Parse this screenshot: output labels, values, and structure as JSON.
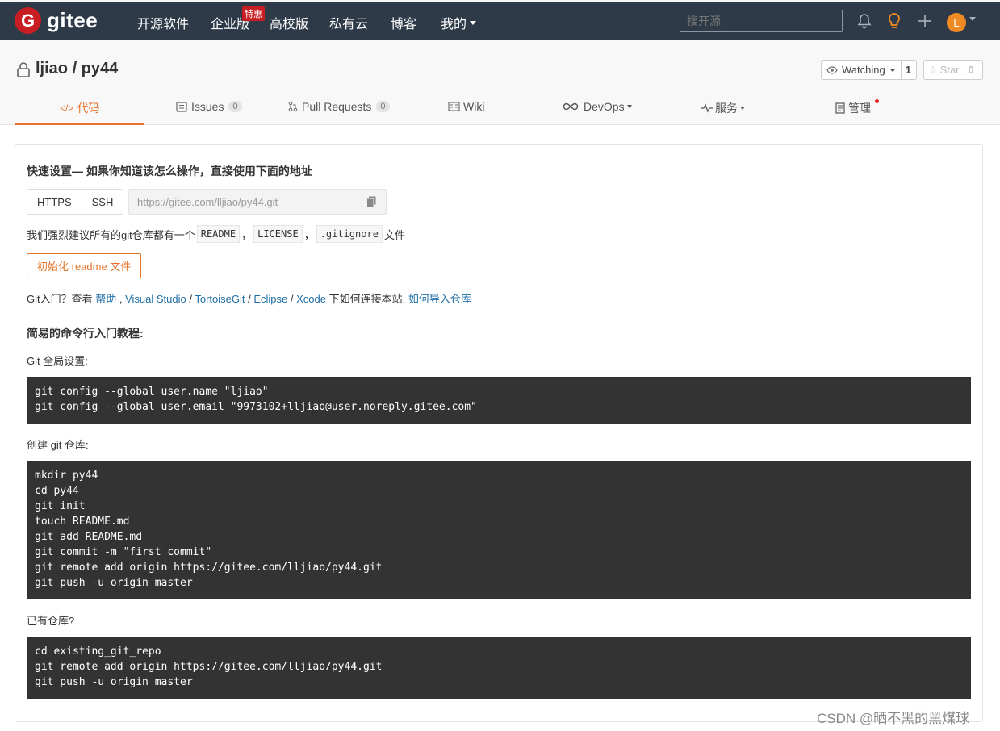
{
  "navbar": {
    "logo_letter": "G",
    "logo_text": "gitee",
    "items": [
      "开源软件",
      "企业版",
      "高校版",
      "私有云",
      "博客",
      "我的"
    ],
    "badge": "特惠",
    "search_placeholder": "搜开源",
    "avatar_letter": "L",
    "accent_color": "#c71d23",
    "bg_color": "#2e3a48"
  },
  "project": {
    "title": "ljiao / py44",
    "watching_label": "Watching",
    "watching_count": "1",
    "star_label": "Star",
    "star_count": "0",
    "tabs": [
      {
        "label": "代码"
      },
      {
        "label": "Issues",
        "count": "0"
      },
      {
        "label": "Pull Requests",
        "count": "0"
      },
      {
        "label": "Wiki"
      },
      {
        "label": "DevOps"
      },
      {
        "label": "服务"
      },
      {
        "label": "管理"
      }
    ],
    "active_tab": "代码",
    "active_color": "#e6722a"
  },
  "quick": {
    "title": "快速设置— 如果你知道该怎么操作，直接使用下面的地址",
    "https_label": "HTTPS",
    "ssh_label": "SSH",
    "url": "https://gitee.com/lljiao/py44.git",
    "recommend_prefix": "我们强烈建议所有的git仓库都有一个",
    "chips": [
      "README",
      "LICENSE",
      ".gitignore"
    ],
    "sep": "，",
    "recommend_suffix": "文件",
    "init_button": "初始化 readme 文件",
    "help_prefix": "Git入门？查看 ",
    "help_link": "帮助",
    "help_mid": " , ",
    "tools": [
      "Visual Studio",
      "TortoiseGit",
      "Eclipse",
      "Xcode"
    ],
    "tool_sep": " / ",
    "help_after": " 下如何连接本站, ",
    "import_link": "如何导入仓库"
  },
  "tutorial": {
    "title": "简易的命令行入门教程:",
    "global_label": "Git 全局设置:",
    "global_code": "git config --global user.name \"ljiao\"\ngit config --global user.email \"9973102+lljiao@user.noreply.gitee.com\"",
    "create_label": "创建 git 仓库:",
    "create_code": "mkdir py44\ncd py44\ngit init\ntouch README.md\ngit add README.md\ngit commit -m \"first commit\"\ngit remote add origin https://gitee.com/lljiao/py44.git\ngit push -u origin master",
    "existing_label": "已有仓库?",
    "existing_code": "cd existing_git_repo\ngit remote add origin https://gitee.com/lljiao/py44.git\ngit push -u origin master"
  },
  "watermark": "CSDN @晒不黑的黑煤球"
}
